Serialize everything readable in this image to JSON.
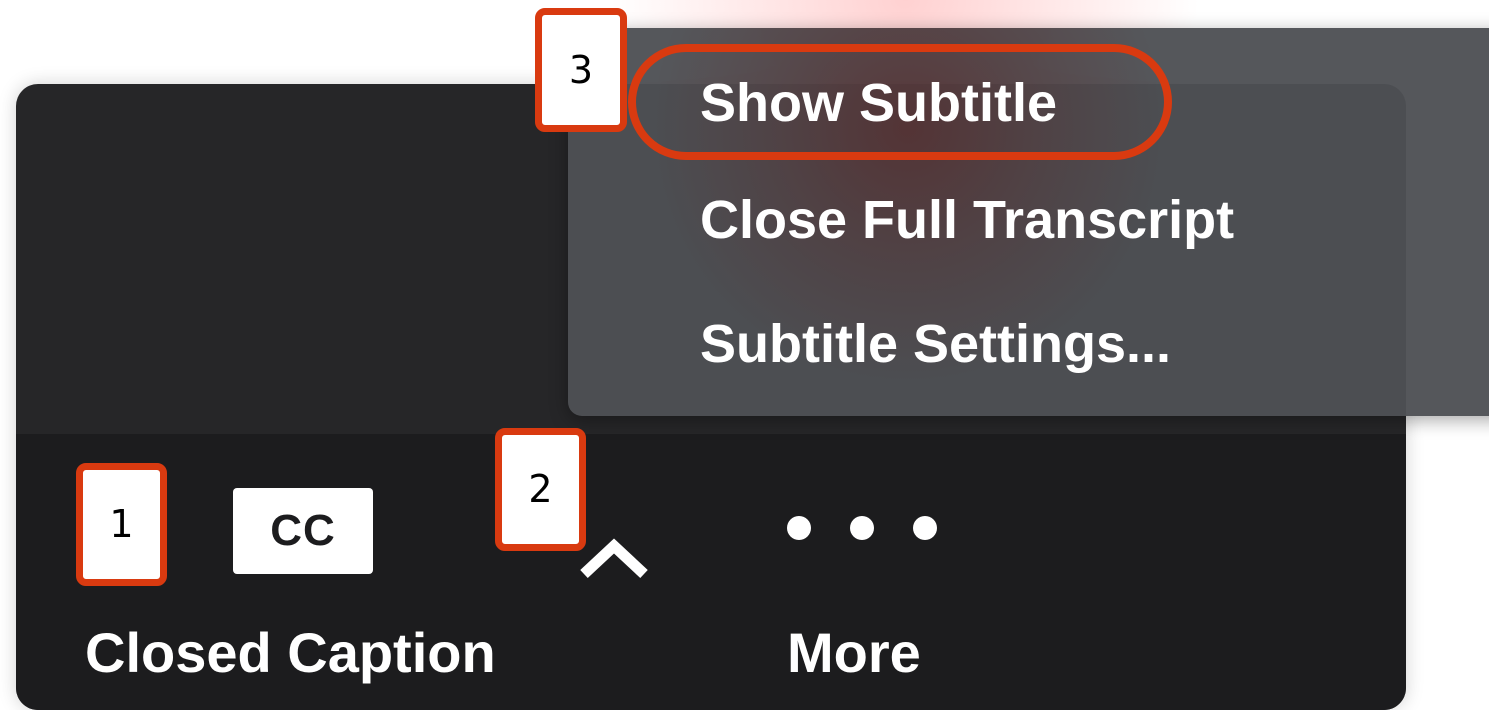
{
  "menu": {
    "items": [
      {
        "label": "Show Subtitle"
      },
      {
        "label": "Close Full Transcript"
      },
      {
        "label": "Subtitle Settings..."
      }
    ]
  },
  "toolbar": {
    "cc_icon_text": "CC",
    "closed_caption_label": "Closed Caption",
    "more_label": "More",
    "icons": {
      "cc": "closed-caption-icon",
      "caret": "chevron-up-icon",
      "more": "more-dots-icon"
    }
  },
  "markers": [
    {
      "number": "1"
    },
    {
      "number": "2"
    },
    {
      "number": "3"
    }
  ],
  "colors": {
    "panel_background": "#262628",
    "toolbar_background": "#1c1c1e",
    "menu_background": "#4e5054",
    "highlight": "#d93a10",
    "text": "#ffffff"
  }
}
